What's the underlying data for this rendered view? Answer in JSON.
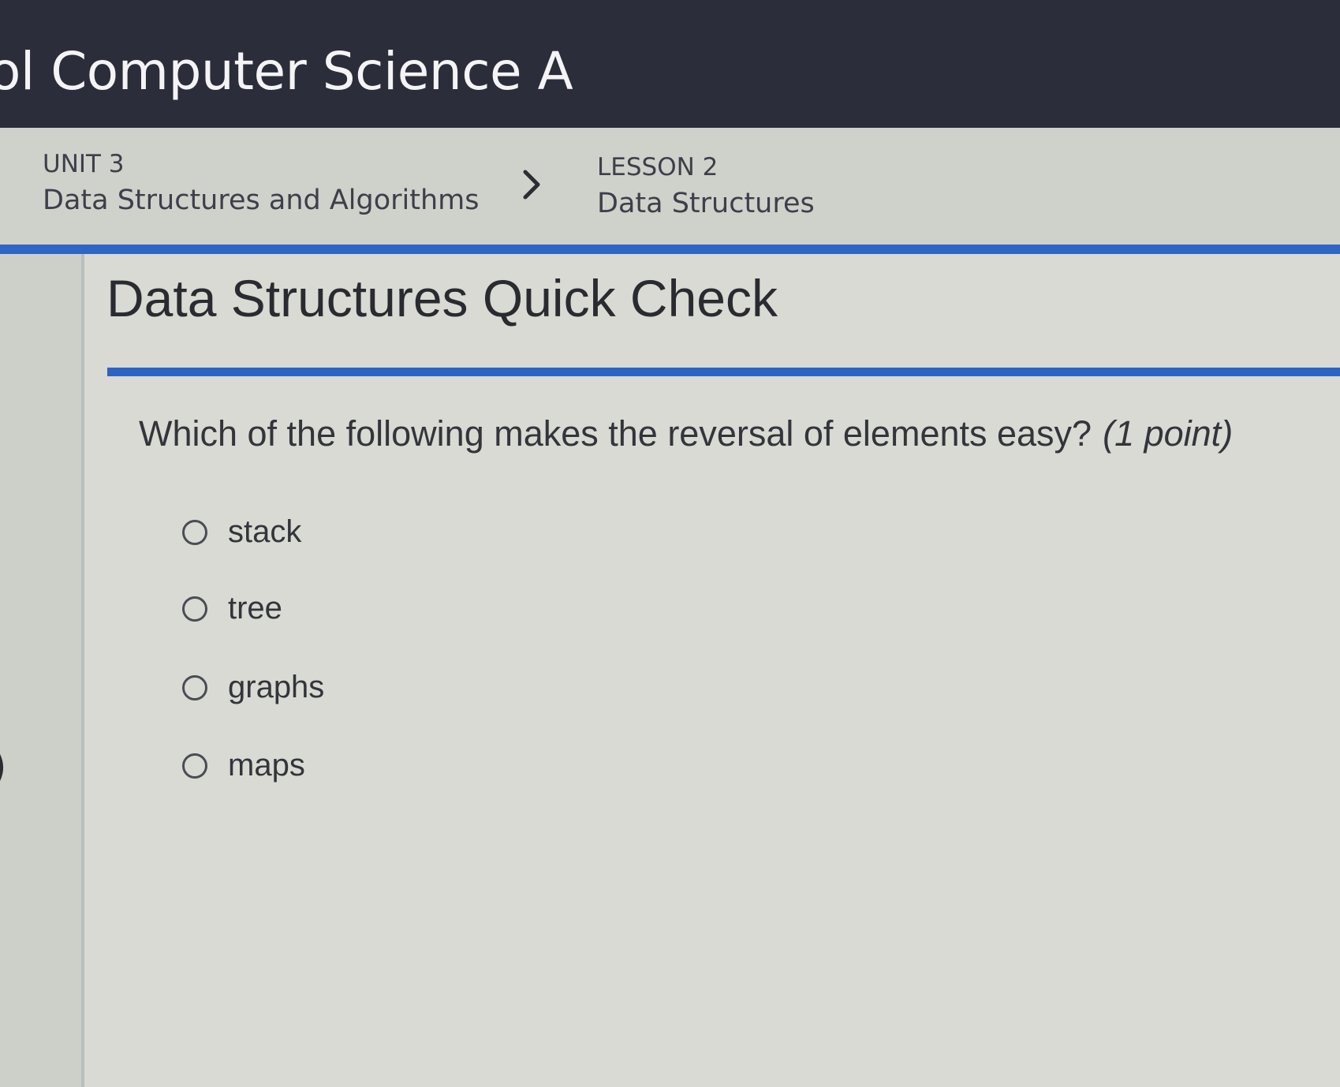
{
  "header": {
    "course_title": "ol Computer Science A"
  },
  "breadcrumb": {
    "unit_label": "UNIT 3",
    "unit_name": "Data Structures and Algorithms",
    "separator_icon": "chevron-right-icon",
    "lesson_label": "LESSON 2",
    "lesson_name": "Data Structures"
  },
  "quiz": {
    "title": "Data Structures Quick Check",
    "question": "Which of the following makes the reversal of elements easy?",
    "points": "(1 point)",
    "options": [
      {
        "label": "stack",
        "selected": false
      },
      {
        "label": "tree",
        "selected": false
      },
      {
        "label": "graphs",
        "selected": false
      },
      {
        "label": "maps",
        "selected": false
      }
    ]
  },
  "colors": {
    "top_bar": "#2c2d3a",
    "accent_blue": "#2f65c5",
    "page_background": "#d8dad3"
  }
}
